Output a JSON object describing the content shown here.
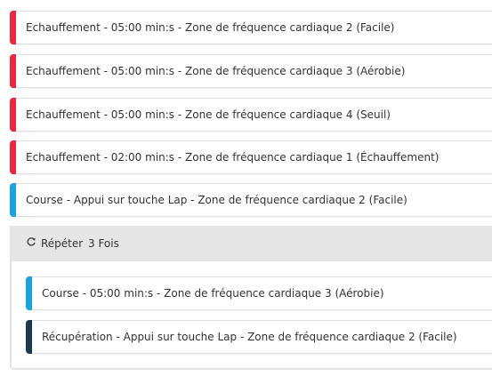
{
  "steps": [
    {
      "label": "Echauffement - 05:00 min:s - Zone de fréquence cardiaque 2 (Facile)",
      "color": "#e8283c"
    },
    {
      "label": "Echauffement - 05:00 min:s - Zone de fréquence cardiaque 3 (Aérobie)",
      "color": "#e8283c"
    },
    {
      "label": "Echauffement - 05:00 min:s - Zone de fréquence cardiaque 4 (Seuil)",
      "color": "#e8283c"
    },
    {
      "label": "Echauffement - 02:00 min:s - Zone de fréquence cardiaque 1 (Échauffement)",
      "color": "#e8283c"
    },
    {
      "label": "Course - Appui sur touche Lap - Zone de fréquence cardiaque 2 (Facile)",
      "color": "#1ba3e0"
    }
  ],
  "repeat": {
    "icon": "repeat-icon",
    "label": "Répéter",
    "count": "3 Fois",
    "steps": [
      {
        "label": "Course - 05:00 min:s - Zone de fréquence cardiaque 3 (Aérobie)",
        "color": "#1ba3e0"
      },
      {
        "label": "Récupération - Appui sur touche Lap - Zone de fréquence cardiaque 2 (Facile)",
        "color": "#1c3a4f"
      }
    ]
  }
}
